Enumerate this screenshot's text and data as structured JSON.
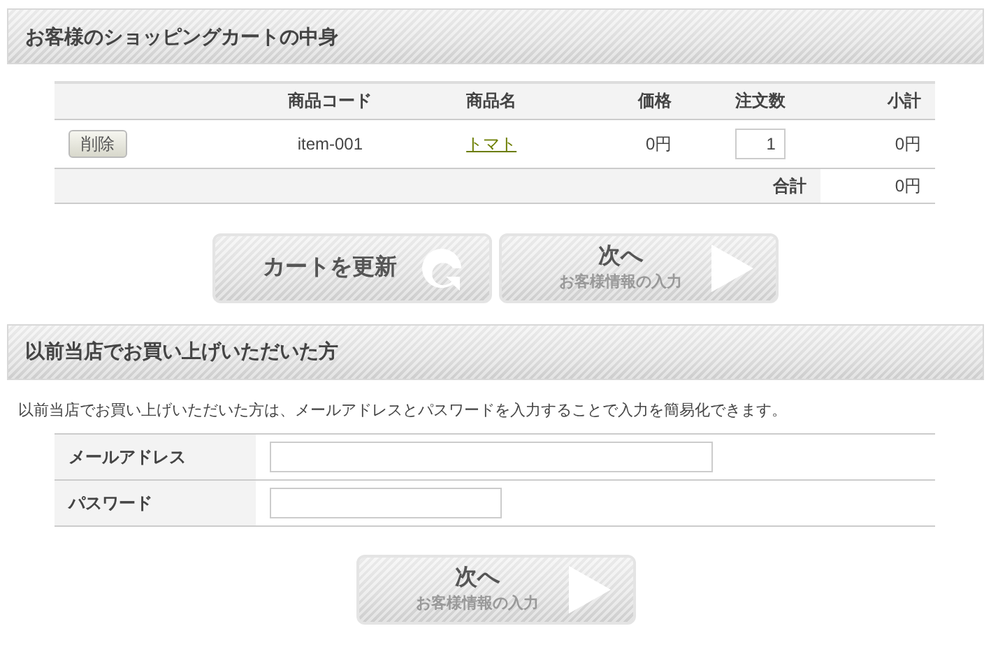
{
  "cart_section": {
    "title": "お客様のショッピングカートの中身",
    "table": {
      "columns": [
        "",
        "商品コード",
        "商品名",
        "価格",
        "注文数",
        "小計"
      ],
      "rows": [
        {
          "delete_button": "削除",
          "code": "item-001",
          "name": "トマト",
          "price": "0円",
          "quantity": "1",
          "subtotal": "0円"
        }
      ],
      "total_label": "合計",
      "total": "0円"
    },
    "buttons": [
      {
        "kind": "update",
        "label": "カートを更新"
      },
      {
        "kind": "next",
        "label": "次へ",
        "sublabel": "お客様情報の入力"
      }
    ]
  },
  "login_section": {
    "title": "以前当店でお買い上げいただいた方",
    "description": "以前当店でお買い上げいただいた方は、メールアドレスとパスワードを入力することで入力を簡易化できます。",
    "fields": [
      {
        "kind": "email",
        "label": "メールアドレス"
      },
      {
        "kind": "password",
        "label": "パスワード"
      }
    ],
    "buttons": [
      {
        "kind": "next",
        "label": "次へ",
        "sublabel": "お客様情報の入力"
      }
    ]
  }
}
